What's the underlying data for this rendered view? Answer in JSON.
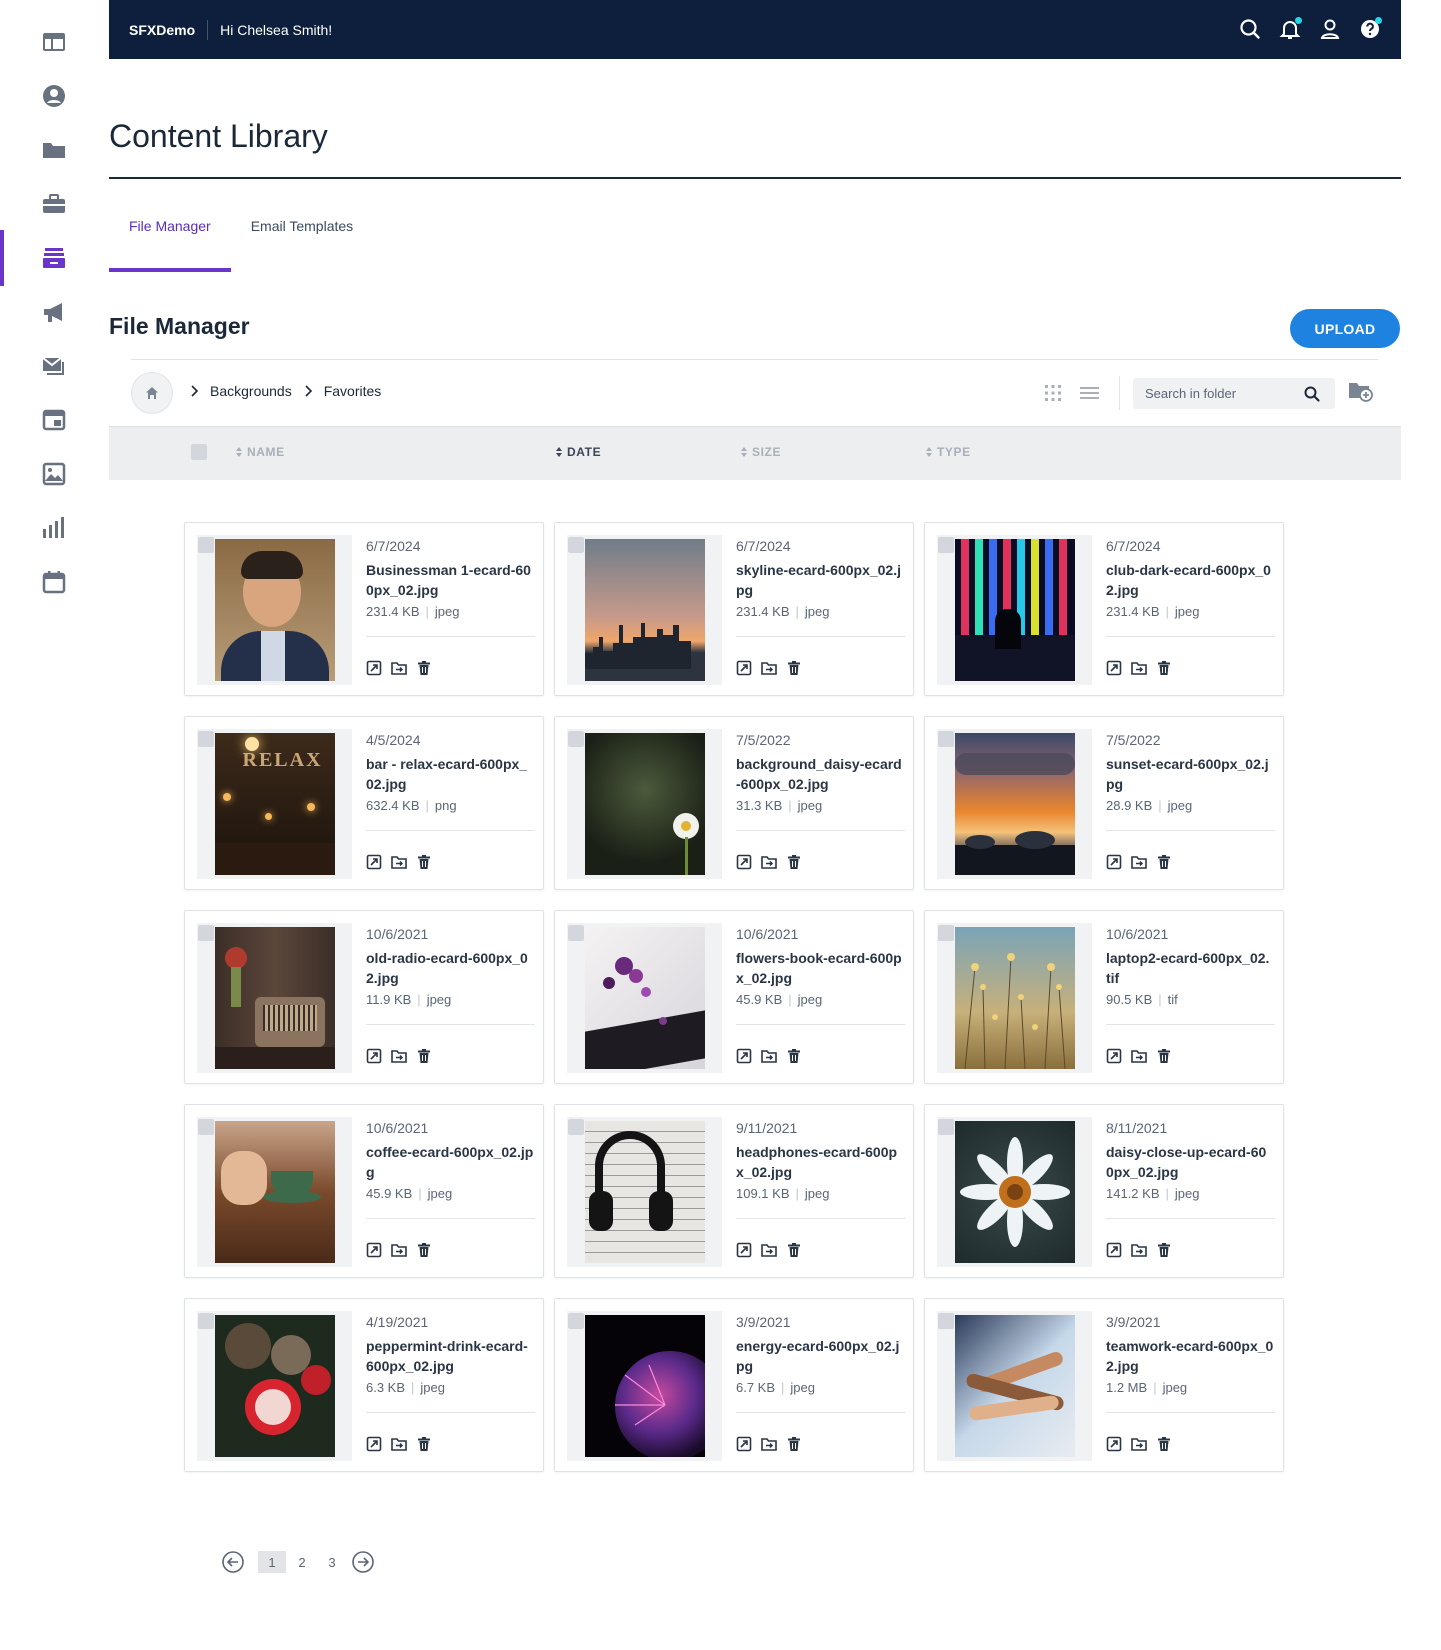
{
  "app": {
    "brand": "SFXDemo",
    "greeting": "Hi Chelsea Smith!"
  },
  "page": {
    "title": "Content Library"
  },
  "tabs": [
    {
      "label": "File Manager",
      "active": true
    },
    {
      "label": "Email Templates",
      "active": false
    }
  ],
  "file_manager": {
    "title": "File Manager",
    "upload_label": "UPLOAD",
    "breadcrumbs": [
      "Backgrounds",
      "Favorites"
    ],
    "search_placeholder": "Search in folder"
  },
  "columns": [
    "NAME",
    "DATE",
    "SIZE",
    "TYPE"
  ],
  "files": [
    {
      "date": "6/7/2024",
      "name": "Businessman 1-ecard-600px_02.jpg",
      "size": "231.4 KB",
      "type": "jpeg",
      "thumb": "portrait"
    },
    {
      "date": "6/7/2024",
      "name": "skyline-ecard-600px_02.jpg",
      "size": "231.4 KB",
      "type": "jpeg",
      "thumb": "skyline"
    },
    {
      "date": "6/7/2024",
      "name": "club-dark-ecard-600px_02.jpg",
      "size": "231.4 KB",
      "type": "jpeg",
      "thumb": "club"
    },
    {
      "date": "4/5/2024",
      "name": "bar - relax-ecard-600px_02.jpg",
      "size": "632.4 KB",
      "type": "png",
      "thumb": "bar"
    },
    {
      "date": "7/5/2022",
      "name": "background_daisy-ecard-600px_02.jpg",
      "size": "31.3 KB",
      "type": "jpeg",
      "thumb": "daisy-dark"
    },
    {
      "date": "7/5/2022",
      "name": "sunset-ecard-600px_02.jpg",
      "size": "28.9 KB",
      "type": "jpeg",
      "thumb": "sunset"
    },
    {
      "date": "10/6/2021",
      "name": "old-radio-ecard-600px_02.jpg",
      "size": "11.9 KB",
      "type": "jpeg",
      "thumb": "radio"
    },
    {
      "date": "10/6/2021",
      "name": "flowers-book-ecard-600px_02.jpg",
      "size": "45.9 KB",
      "type": "jpeg",
      "thumb": "flowers"
    },
    {
      "date": "10/6/2021",
      "name": "laptop2-ecard-600px_02.tif",
      "size": "90.5 KB",
      "type": "tif",
      "thumb": "meadow"
    },
    {
      "date": "10/6/2021",
      "name": "coffee-ecard-600px_02.jpg",
      "size": "45.9 KB",
      "type": "jpeg",
      "thumb": "coffee"
    },
    {
      "date": "9/11/2021",
      "name": "headphones-ecard-600px_02.jpg",
      "size": "109.1 KB",
      "type": "jpeg",
      "thumb": "headphones"
    },
    {
      "date": "8/11/2021",
      "name": "daisy-close-up-ecard-600px_02.jpg",
      "size": "141.2 KB",
      "type": "jpeg",
      "thumb": "daisy"
    },
    {
      "date": "4/19/2021",
      "name": "peppermint-drink-ecard-600px_02.jpg",
      "size": "6.3 KB",
      "type": "jpeg",
      "thumb": "peppermint"
    },
    {
      "date": "3/9/2021",
      "name": "energy-ecard-600px_02.jpg",
      "size": "6.7 KB",
      "type": "jpeg",
      "thumb": "energy"
    },
    {
      "date": "3/9/2021",
      "name": "teamwork-ecard-600px_02.jpg",
      "size": "1.2 MB",
      "type": "jpeg",
      "thumb": "teamwork"
    }
  ],
  "pagination": {
    "pages": [
      "1",
      "2",
      "3"
    ],
    "current": "1"
  },
  "colors": {
    "nav": "#0d1f3c",
    "accent": "#6b35c9",
    "upload": "#1e82e0",
    "badge": "#25d7e6"
  },
  "icons": {
    "rail": [
      "dashboard-icon",
      "contacts-icon",
      "folder-icon",
      "briefcase-icon",
      "content-library-icon",
      "campaign-icon",
      "email-icon",
      "landing-page-icon",
      "image-icon",
      "reports-icon",
      "calendar-icon"
    ],
    "card_actions": [
      "open-icon",
      "move-icon",
      "delete-icon"
    ]
  }
}
